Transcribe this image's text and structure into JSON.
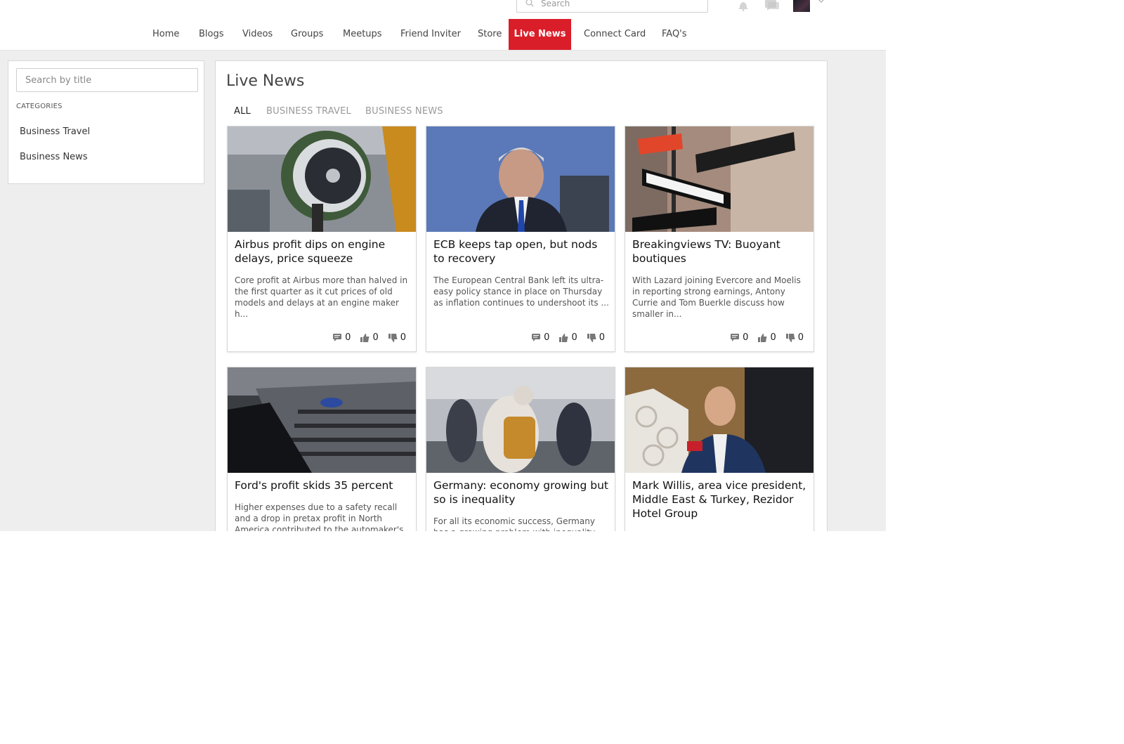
{
  "header": {
    "search_placeholder": "Search",
    "icons": [
      "bell-icon",
      "messages-icon",
      "avatar",
      "chevron-down-icon"
    ]
  },
  "nav": [
    {
      "label": "Home"
    },
    {
      "label": "Blogs"
    },
    {
      "label": "Videos"
    },
    {
      "label": "Groups"
    },
    {
      "label": "Meetups"
    },
    {
      "label": "Friend Inviter"
    },
    {
      "label": "Store"
    },
    {
      "label": "Live News",
      "active": true
    },
    {
      "label": "Connect Card"
    },
    {
      "label": "FAQ's"
    }
  ],
  "sidebar": {
    "search_placeholder": "Search by title",
    "categories_heading": "CATEGORIES",
    "categories": [
      "Business Travel",
      "Business News"
    ]
  },
  "main": {
    "title": "Live News",
    "tabs": [
      "ALL",
      "BUSINESS TRAVEL",
      "BUSINESS NEWS"
    ],
    "active_tab": "ALL",
    "cards": [
      {
        "title": "Airbus profit dips on engine delays, price squeeze",
        "desc": "Core profit at Airbus more than halved in the first quarter as it cut prices of old models and delays at an engine maker h...",
        "comments": "0",
        "likes": "0",
        "dislikes": "0"
      },
      {
        "title": "ECB keeps tap open, but nods to recovery",
        "desc": "The European Central Bank left its ultra-easy policy stance in place on Thursday as inflation continues to undershoot its ...",
        "comments": "0",
        "likes": "0",
        "dislikes": "0"
      },
      {
        "title": "Breakingviews TV: Buoyant boutiques",
        "desc": "With Lazard joining Evercore and Moelis in reporting strong earnings, Antony Currie and Tom Buerkle discuss how smaller in...",
        "comments": "0",
        "likes": "0",
        "dislikes": "0"
      },
      {
        "title": "Ford's profit skids 35 percent",
        "desc": "Higher expenses due to a safety recall and a drop in pretax profit in North America contributed to the automaker's"
      },
      {
        "title": "Germany: economy growing but so is inequality",
        "desc": "For all its economic success, Germany has a growing problem with inequality"
      },
      {
        "title": "Mark Willis, area vice president, Middle East & Turkey, Rezidor Hotel Group",
        "desc": ""
      }
    ]
  },
  "colors": {
    "accent": "#d91e2a",
    "page_bg": "#eeeeee",
    "tab_inactive": "#9a9a9a"
  }
}
